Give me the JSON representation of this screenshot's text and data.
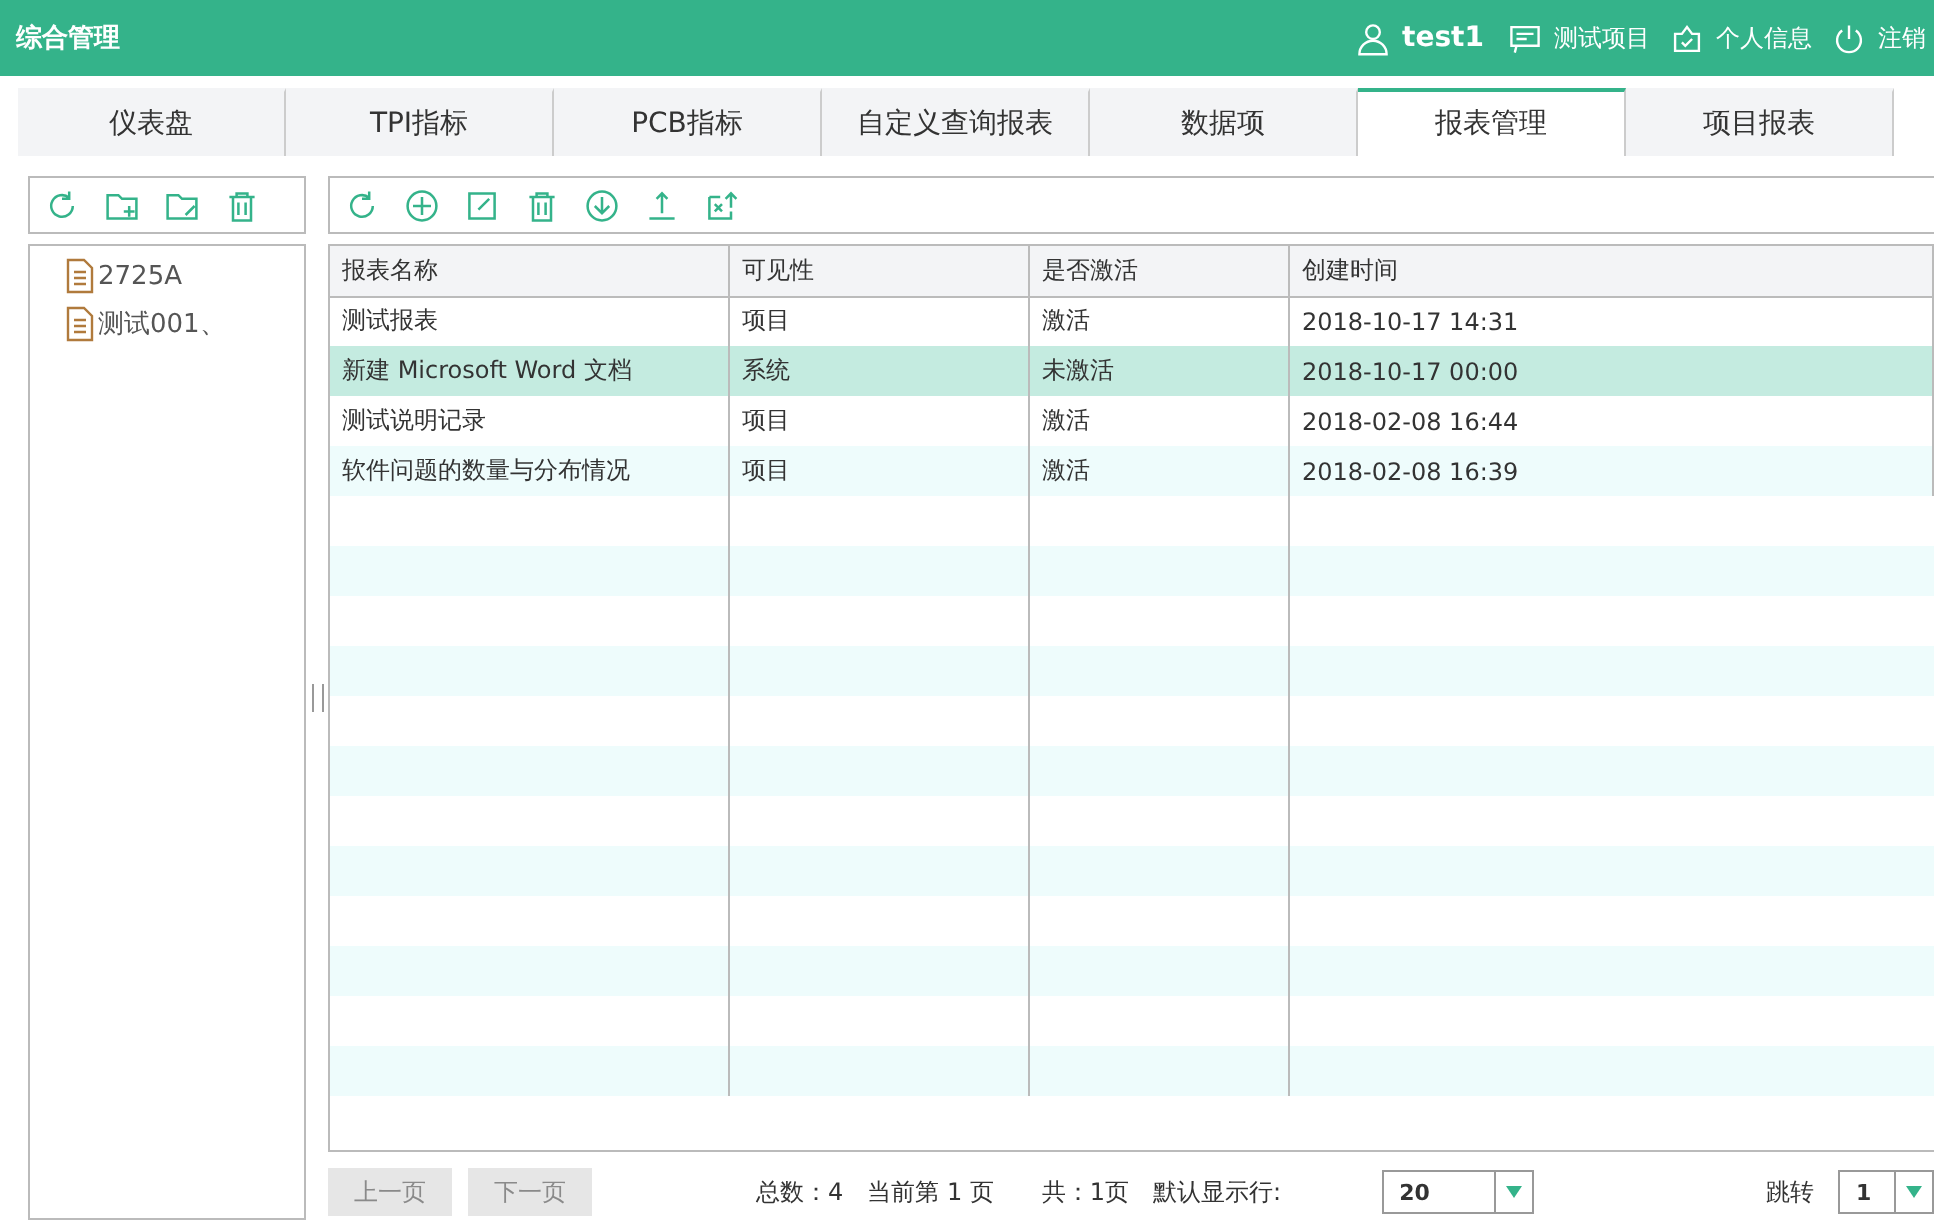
{
  "header": {
    "title": "综合管理",
    "user": "test1",
    "links": [
      {
        "kind": "project",
        "label": "测试项目"
      },
      {
        "kind": "profile",
        "label": "个人信息"
      },
      {
        "kind": "logout",
        "label": "注销"
      }
    ]
  },
  "tabs": [
    {
      "label": "仪表盘",
      "selected": false
    },
    {
      "label": "TPI指标",
      "selected": false
    },
    {
      "label": "PCB指标",
      "selected": false
    },
    {
      "label": "自定义查询报表",
      "selected": false
    },
    {
      "label": "数据项",
      "selected": false
    },
    {
      "label": "报表管理",
      "selected": true
    },
    {
      "label": "项目报表",
      "selected": false
    }
  ],
  "tree": {
    "toolbar": [
      {
        "kind": "refresh"
      },
      {
        "kind": "folder-add"
      },
      {
        "kind": "folder-edit"
      },
      {
        "kind": "delete"
      }
    ],
    "items": [
      {
        "label": "2725A"
      },
      {
        "label": "测试001、"
      }
    ]
  },
  "table": {
    "toolbar": [
      {
        "kind": "refresh"
      },
      {
        "kind": "add"
      },
      {
        "kind": "edit"
      },
      {
        "kind": "delete"
      },
      {
        "kind": "download"
      },
      {
        "kind": "upload"
      },
      {
        "kind": "export"
      }
    ],
    "columns": [
      "报表名称",
      "可见性",
      "是否激活",
      "创建时间"
    ],
    "rows": [
      {
        "cells": [
          "测试报表",
          "项目",
          "激活",
          "2018-10-17 14:31"
        ],
        "selected": false
      },
      {
        "cells": [
          "新建 Microsoft Word 文档",
          "系统",
          "未激活",
          "2018-10-17 00:00"
        ],
        "selected": true
      },
      {
        "cells": [
          "测试说明记录",
          "项目",
          "激活",
          "2018-02-08 16:44"
        ],
        "selected": false
      },
      {
        "cells": [
          "软件问题的数量与分布情况",
          "项目",
          "激活",
          "2018-02-08 16:39"
        ],
        "selected": false
      }
    ]
  },
  "pager": {
    "prev": {
      "label": "上一页",
      "disabled": true
    },
    "next": {
      "label": "下一页",
      "disabled": true
    },
    "total": "总数：4",
    "current": "当前第 1 页",
    "pages": "共：1页",
    "rows_label": "默认显示行:",
    "rows_value": "20",
    "jump_label": "跳转",
    "jump_value": "1"
  }
}
